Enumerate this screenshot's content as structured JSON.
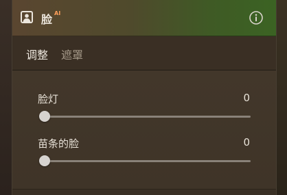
{
  "panel": {
    "title": "脸",
    "title_badge": "AI",
    "header_icon": "face-portrait-icon",
    "info_icon": "info-icon"
  },
  "tabs": [
    {
      "label": "调整",
      "active": true
    },
    {
      "label": "遮罩",
      "active": false
    }
  ],
  "sliders": [
    {
      "label": "脸灯",
      "value": "0",
      "level": 0
    },
    {
      "label": "苗条的脸",
      "value": "0",
      "level": 0
    }
  ],
  "colors": {
    "header_gradient_start": "#5a4630",
    "header_gradient_end": "#3b6323",
    "badge_accent": "#ff9f5a",
    "panel_bg": "#3c3226"
  }
}
